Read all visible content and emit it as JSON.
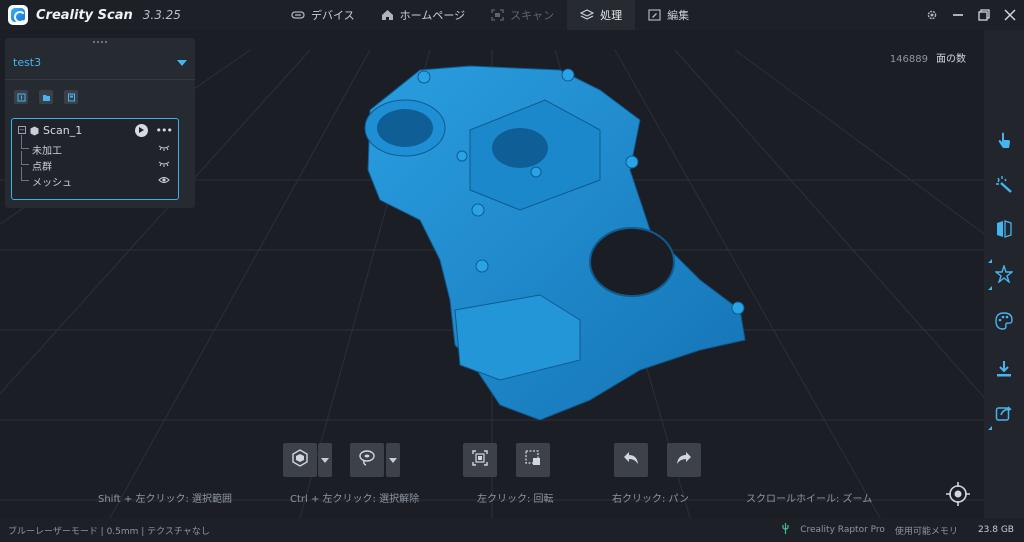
{
  "app": {
    "name": "Creality Scan",
    "version": "3.3.25"
  },
  "nav": [
    {
      "label": "デバイス",
      "icon": "device-icon",
      "state": "normal"
    },
    {
      "label": "ホームページ",
      "icon": "home-icon",
      "state": "normal"
    },
    {
      "label": "スキャン",
      "icon": "scan-icon",
      "state": "disabled"
    },
    {
      "label": "処理",
      "icon": "process-icon",
      "state": "active"
    },
    {
      "label": "編集",
      "icon": "edit-icon",
      "state": "normal"
    }
  ],
  "project": {
    "name": "test3",
    "scan": {
      "title": "Scan_1",
      "items": [
        {
          "label": "未加工",
          "visibility": "hidden"
        },
        {
          "label": "点群",
          "visibility": "hidden"
        },
        {
          "label": "メッシュ",
          "visibility": "visible"
        }
      ]
    }
  },
  "viewport": {
    "face_count_value": "146889",
    "face_count_label": "面の数",
    "model_color": "#1f8fd0"
  },
  "hints": {
    "shift": "Shift + 左クリック:  選択範囲",
    "ctrl": "Ctrl + 左クリック:  選択解除",
    "left": "左クリック:  回転",
    "right": "右クリック:  パン",
    "scroll": "スクロールホイール:  ズーム"
  },
  "right_toolbar": [
    "touch-select-icon",
    "magic-wand-icon",
    "mirror-icon",
    "star-edit-icon",
    "palette-icon",
    "download-icon",
    "export-icon"
  ],
  "status": {
    "mode": "ブルーレーザーモード | 0.5mm | テクスチャなし",
    "device": "Creality Raptor Pro",
    "memory_label": "使用可能メモリ",
    "memory_value": "23.8 GB"
  },
  "colors": {
    "accent": "#45b5ef",
    "background": "#1b1e24",
    "panel": "#262a31"
  }
}
